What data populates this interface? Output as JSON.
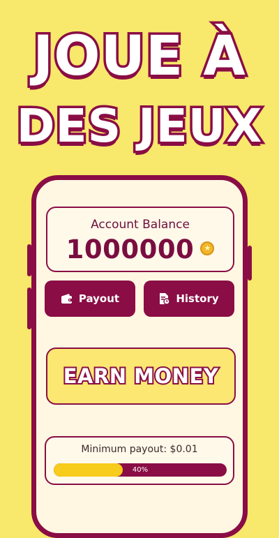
{
  "headline": {
    "line1": "JOUE À",
    "line2": "DES JEUX"
  },
  "balance": {
    "label": "Account Balance",
    "value": "1000000"
  },
  "buttons": {
    "payout": "Payout",
    "history": "History"
  },
  "earn": {
    "label": "EARN MONEY"
  },
  "payout": {
    "minimum_label": "Minimum payout: $0.01",
    "progress": 0.4,
    "progress_text": "40%"
  },
  "icons": {
    "coin": "coin-icon",
    "wallet": "wallet-icon",
    "history": "document-clock-icon"
  },
  "colors": {
    "background": "#f8e86b",
    "accent": "#8a0d45",
    "progress": "#f7cc1a"
  }
}
